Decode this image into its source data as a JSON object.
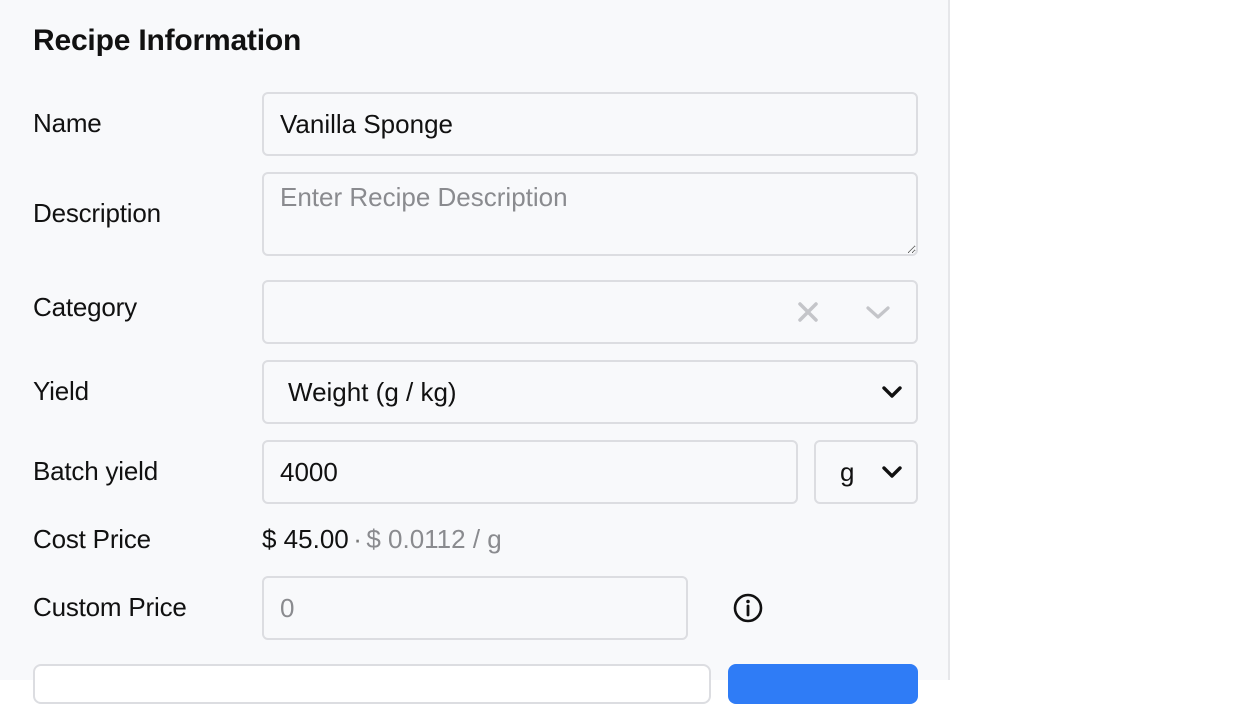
{
  "section": {
    "title": "Recipe Information"
  },
  "fields": {
    "name": {
      "label": "Name",
      "value": "Vanilla Sponge"
    },
    "description": {
      "label": "Description",
      "placeholder": "Enter Recipe Description"
    },
    "category": {
      "label": "Category",
      "value": ""
    },
    "yield": {
      "label": "Yield",
      "selected": "Weight (g / kg)"
    },
    "batch_yield": {
      "label": "Batch yield",
      "value": "4000",
      "unit": "g"
    },
    "cost_price": {
      "label": "Cost Price",
      "total": "$ 45.00",
      "separator": "·",
      "per_unit": "$ 0.0112 / g"
    },
    "custom_price": {
      "label": "Custom Price",
      "placeholder": "0"
    }
  },
  "icons": {
    "clear": "close-icon",
    "dropdown": "chevron-down-icon",
    "info": "info-icon"
  },
  "colors": {
    "panel_bg": "#f8f9fb",
    "accent": "#2f7cf6"
  }
}
